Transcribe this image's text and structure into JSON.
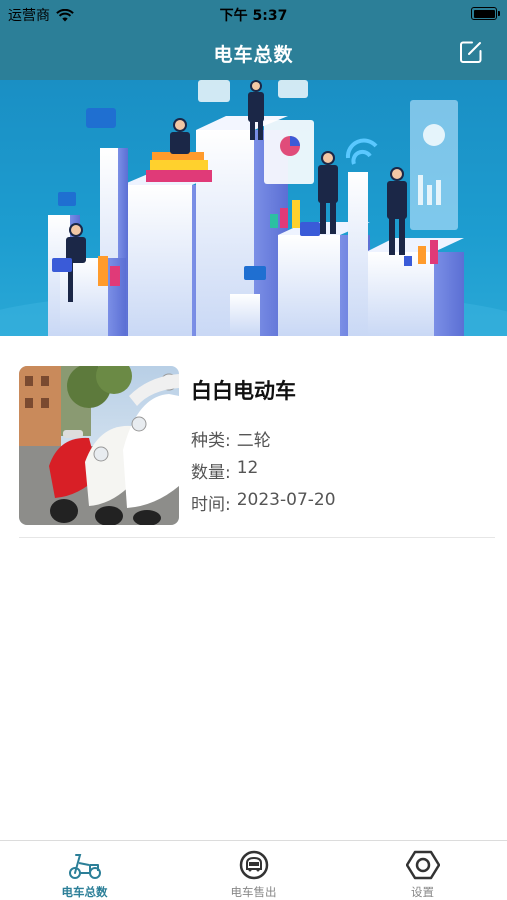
{
  "status_bar": {
    "carrier": "运营商",
    "time": "下午 5:37"
  },
  "nav": {
    "title": "电车总数",
    "edit_icon": "edit-icon"
  },
  "banner": {
    "image": "business-data-illustration"
  },
  "items": [
    {
      "name": "白白电动车",
      "type_label": "种类:",
      "type_value": "二轮",
      "count_label": "数量:",
      "count_value": "12",
      "date_label": "时间:",
      "date_value": "2023-07-20",
      "image": "scooter-photo"
    }
  ],
  "tabbar": {
    "tabs": [
      {
        "label": "电车总数",
        "icon": "scooter-icon",
        "active": true
      },
      {
        "label": "电车售出",
        "icon": "car-badge-icon",
        "active": false
      },
      {
        "label": "设置",
        "icon": "hexagon-settings-icon",
        "active": false
      }
    ]
  },
  "colors": {
    "header": "#2c7f98",
    "accent": "#2c7f98",
    "banner": "#1d9dd0"
  }
}
